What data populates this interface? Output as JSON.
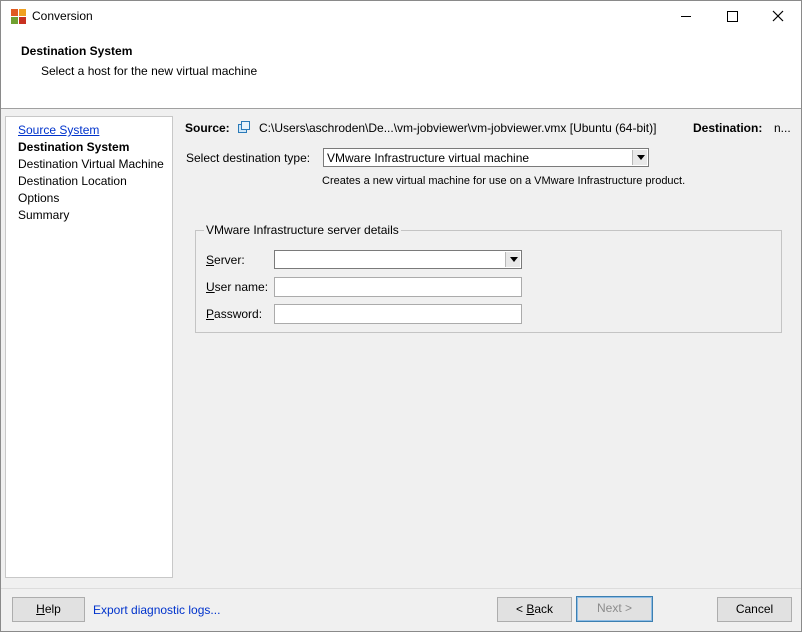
{
  "window": {
    "title": "Conversion"
  },
  "header": {
    "title": "Destination System",
    "subtitle": "Select a host for the new virtual machine"
  },
  "nav": {
    "items": [
      {
        "label": "Source System",
        "state": "link"
      },
      {
        "label": "Destination System",
        "state": "current"
      },
      {
        "label": "Destination Virtual Machine",
        "state": "normal"
      },
      {
        "label": "Destination Location",
        "state": "normal"
      },
      {
        "label": "Options",
        "state": "normal"
      },
      {
        "label": "Summary",
        "state": "normal"
      }
    ]
  },
  "summary": {
    "source_label": "Source:",
    "source_icon": "vm-icon",
    "source_path": "C:\\Users\\aschroden\\De...\\vm-jobviewer\\vm-jobviewer.vmx [Ubuntu (64-bit)]",
    "destination_label": "Destination:",
    "destination_value": "n..."
  },
  "destination_type": {
    "label": "Select destination type:",
    "selected": "VMware Infrastructure virtual machine",
    "description": "Creates a new virtual machine for use on a VMware Infrastructure product."
  },
  "server_details": {
    "legend": "VMware Infrastructure server details",
    "server_label_prefix": "S",
    "server_label_rest": "erver:",
    "server_value": "",
    "username_label_prefix": "U",
    "username_label_rest": "ser name:",
    "username_value": "",
    "password_label_prefix": "P",
    "password_label_rest": "assword:",
    "password_value": ""
  },
  "footer": {
    "help_prefix": "H",
    "help_rest": "elp",
    "export_logs": "Export diagnostic logs...",
    "back_prefix": "< ",
    "back_mnemonic": "B",
    "back_rest": "ack",
    "next": "Next >",
    "cancel": "Cancel"
  },
  "colors": {
    "link": "#0033cc",
    "background": "#f0f0f0",
    "disabled_text": "#8c8c8c"
  }
}
